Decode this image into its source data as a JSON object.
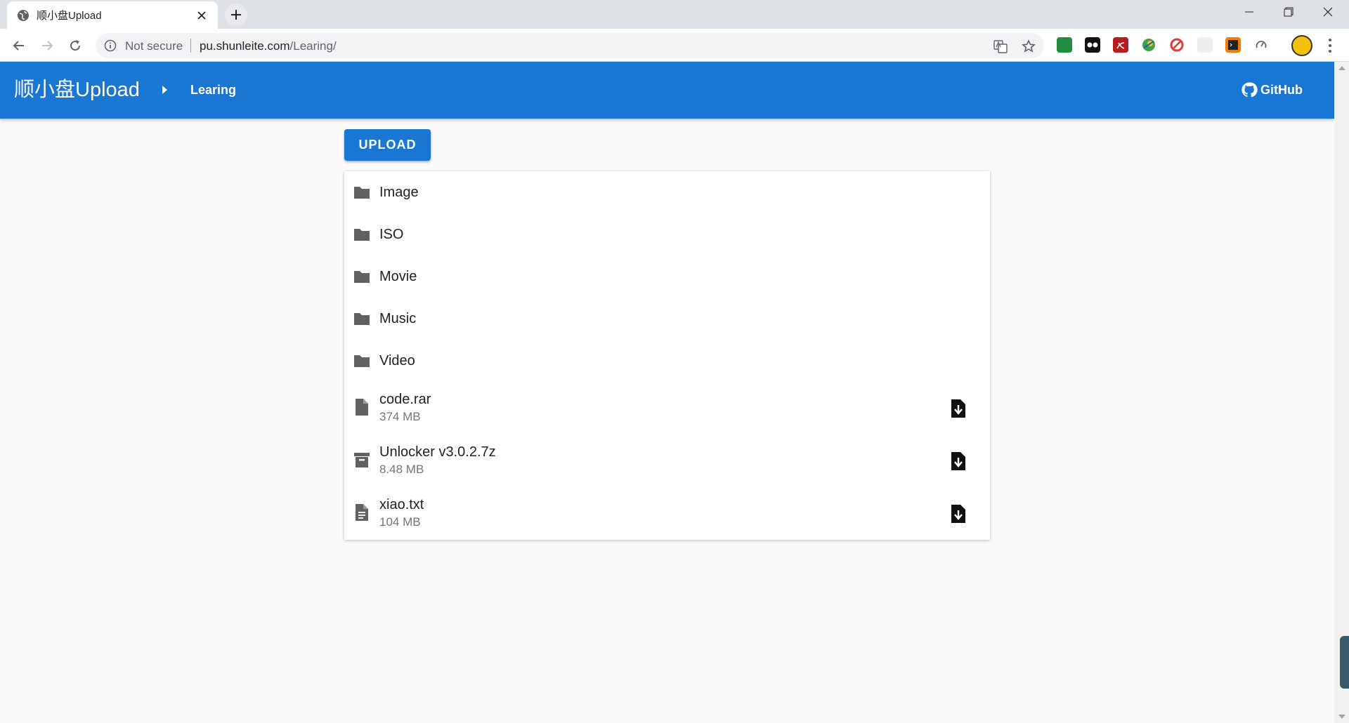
{
  "browser": {
    "tab_title": "顺小盘Upload",
    "security_label": "Not secure",
    "url_host": "pu.shunleite.com",
    "url_path": "/Learing/"
  },
  "appbar": {
    "title": "顺小盘Upload",
    "breadcrumb": "Learing",
    "github_label": "GitHub"
  },
  "upload_button": "UPLOAD",
  "files": [
    {
      "name": "Image",
      "type": "folder"
    },
    {
      "name": "ISO",
      "type": "folder"
    },
    {
      "name": "Movie",
      "type": "folder"
    },
    {
      "name": "Music",
      "type": "folder"
    },
    {
      "name": "Video",
      "type": "folder"
    },
    {
      "name": "code.rar",
      "size": "374 MB",
      "type": "file"
    },
    {
      "name": "Unlocker v3.0.2.7z",
      "size": "8.48 MB",
      "type": "archive"
    },
    {
      "name": "xiao.txt",
      "size": "104 MB",
      "type": "text"
    }
  ],
  "colors": {
    "primary": "#1976d2",
    "background": "#fafafa",
    "icon_grey": "#616161"
  }
}
